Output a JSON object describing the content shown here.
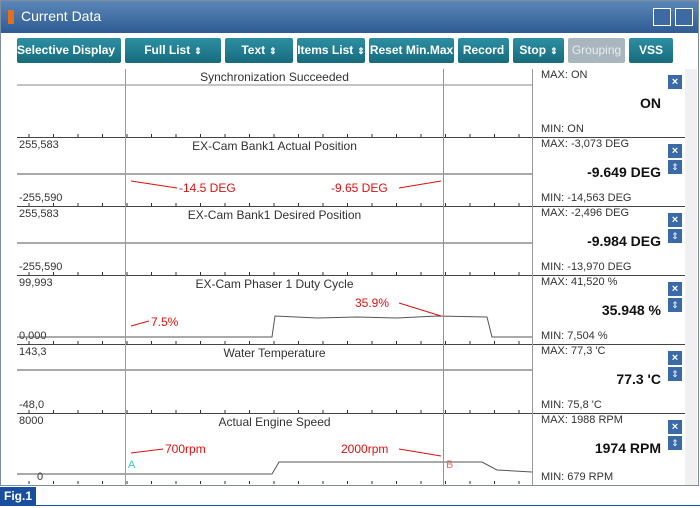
{
  "window": {
    "title": "Current Data"
  },
  "toolbar": {
    "buttons": [
      {
        "label": "Selective Display",
        "chevron": "⇕"
      },
      {
        "label": "Full List",
        "chevron": "⇕"
      },
      {
        "label": "Text",
        "chevron": "⇕"
      },
      {
        "label": "Items List",
        "chevron": "⇕"
      },
      {
        "label": "Reset Min.Max",
        "chevron": ""
      },
      {
        "label": "Record",
        "chevron": ""
      },
      {
        "label": "Stop",
        "chevron": "⇕"
      },
      {
        "label": "Grouping",
        "chevron": ""
      },
      {
        "label": "VSS",
        "chevron": ""
      }
    ]
  },
  "rows": [
    {
      "title": "Synchronization Succeeded",
      "axis_max": "",
      "axis_min": "",
      "max": "MAX: ON",
      "min": "MIN: ON",
      "current": "ON"
    },
    {
      "title": "EX-Cam Bank1 Actual Position",
      "axis_max": "255,583",
      "axis_min": "-255,590",
      "max": "MAX: -3,073 DEG",
      "min": "MIN: -14,563 DEG",
      "current": "-9.649 DEG"
    },
    {
      "title": "EX-Cam Bank1 Desired Position",
      "axis_max": "255,583",
      "axis_min": "-255,590",
      "max": "MAX: -2,496 DEG",
      "min": "MIN: -13,970 DEG",
      "current": "-9.984 DEG"
    },
    {
      "title": "EX-Cam Phaser 1 Duty Cycle",
      "axis_max": "99,993",
      "axis_min": "0,000",
      "max": "MAX: 41,520 %",
      "min": "MIN: 7,504 %",
      "current": "35.948 %"
    },
    {
      "title": "Water Temperature",
      "axis_max": "143,3",
      "axis_min": "-48,0",
      "max": "MAX: 77,3 'C",
      "min": "MIN: 75,8 'C",
      "current": "77.3 'C"
    },
    {
      "title": "Actual Engine Speed",
      "axis_max": "8000",
      "axis_min": "0",
      "max": "MAX: 1988 RPM",
      "min": "MIN: 679 RPM",
      "current": "1974 RPM"
    }
  ],
  "cursors": {
    "a": "A",
    "b": "B"
  },
  "annotations": {
    "cam_a": "-14.5 DEG",
    "cam_b": "-9.65 DEG",
    "duty_a": "7.5%",
    "duty_b": "35.9%",
    "rpm_a": "700rpm",
    "rpm_b": "2000rpm"
  },
  "figure_label": "Fig.1",
  "colors": {
    "accent": "#176b7d",
    "annotation": "#e01010",
    "cursor_a": "#39c5c5",
    "cursor_b": "#f07050"
  }
}
